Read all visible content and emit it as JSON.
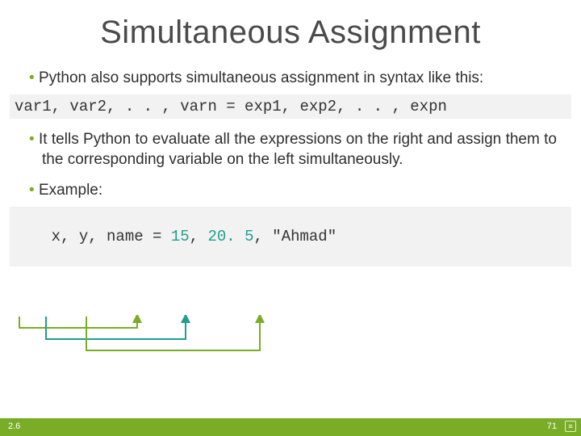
{
  "title": "Simultaneous Assignment",
  "bullet1": "Python also supports simultaneous assignment in syntax like this:",
  "code1": "var1, var2, . . , varn = exp1, exp2, . . , expn",
  "bullet2": "It tells Python to evaluate all the expressions on the right and assign them to the corresponding variable on the left simultaneously.",
  "bullet3": "Example:",
  "code2_plain": "x, y, name = 15, 20.5, \"Ahmad\"",
  "code2": {
    "prefix": "x, y, name = ",
    "n1": "15",
    "sep1": ", ",
    "n2": "20. 5",
    "sep2": ", ",
    "s1": "\"Ahmad\""
  },
  "footer": {
    "section": "2.6",
    "page": "71",
    "icon_glyph": "≡"
  },
  "colors": {
    "accent": "#79ad27",
    "teal": "#1e9e8f"
  }
}
